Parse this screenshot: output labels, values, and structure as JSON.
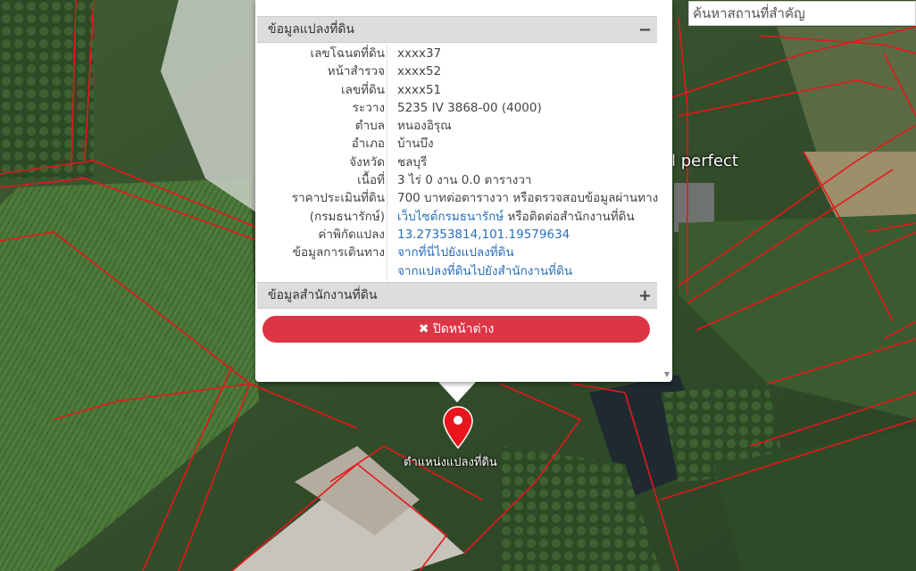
{
  "search": {
    "placeholder": "ค้นหาสถานที่สำคัญ"
  },
  "map": {
    "place_label": "l perfect",
    "marker_label": "ตำแหน่งแปลงที่ดิน",
    "parcel_line_color": "#e8161b",
    "marker_color": "#e8161b"
  },
  "popup": {
    "section_land": {
      "title": "ข้อมูลแปลงที่ดิน",
      "toggle": "−"
    },
    "rows": [
      {
        "label": "เลขโฉนดที่ดิน",
        "value": "xxxx37"
      },
      {
        "label": "หน้าสำรวจ",
        "value": "xxxx52"
      },
      {
        "label": "เลขที่ดิน",
        "value": "xxxx51"
      },
      {
        "label": "ระวาง",
        "value": "5235 IV 3868-00 (4000)"
      },
      {
        "label": "ตำบล",
        "value": "หนองอิรุณ"
      },
      {
        "label": "อำเภอ",
        "value": "บ้านบึง"
      },
      {
        "label": "จังหวัด",
        "value": "ชลบุรี"
      },
      {
        "label": "เนื้อที่",
        "value": "3 ไร่ 0 งาน 0.0 ตารางวา"
      },
      {
        "label": "ราคาประเมินที่ดิน",
        "value": "700 บาทต่อตารางวา หรือตรวจสอบข้อมูลผ่านทาง"
      },
      {
        "label": "(กรมธนารักษ์)",
        "link": "เว็บไซต์กรมธนารักษ์",
        "value": " หรือติดต่อสำนักงานที่ดิน"
      },
      {
        "label": "ค่าพิกัดแปลง",
        "link": "13.27353814,101.19579634"
      },
      {
        "label": "ข้อมูลการเดินทาง",
        "link": "จากที่นี่ไปยังแปลงที่ดิน"
      },
      {
        "label": "",
        "link": "จากแปลงที่ดินไปยังสำนักงานที่ดิน"
      }
    ],
    "section_office": {
      "title": "ข้อมูลสำนักงานที่ดิน",
      "toggle": "+"
    },
    "close_button": {
      "icon": "✖",
      "label": "ปิดหน้าต่าง"
    }
  }
}
